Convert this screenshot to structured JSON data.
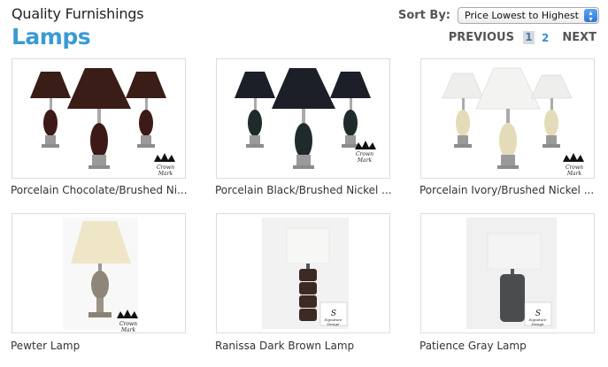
{
  "header": {
    "store_name": "Quality Furnishings",
    "category_title": "Lamps"
  },
  "sort": {
    "label": "Sort By:",
    "selected": "Price Lowest to Highest"
  },
  "pager": {
    "prev": "PREVIOUS",
    "current_page": "1",
    "next_page": "2",
    "next": "NEXT"
  },
  "products": [
    {
      "name": "Porcelain Chocolate/Brushed Ni...",
      "shade_color": "#3a1d16",
      "body_color": "#3d1a18",
      "brand": "Crown Mark"
    },
    {
      "name": "Porcelain Black/Brushed Nickel ...",
      "shade_color": "#1c1f27",
      "body_color": "#1f2a2b",
      "brand": "Crown Mark"
    },
    {
      "name": "Porcelain Ivory/Brushed Nickel ...",
      "shade_color": "#eeeeec",
      "body_color": "#e4dcb8",
      "brand": "Crown Mark"
    },
    {
      "name": "Pewter Lamp",
      "shade_color": "#efe6c8",
      "body_color": "#8e8678",
      "brand": "Crown Mark"
    },
    {
      "name": "Ranissa Dark Brown Lamp",
      "shade_color": "#f7f7f5",
      "body_color": "#3d2a24",
      "brand": "Signature Design"
    },
    {
      "name": "Patience Gray Lamp",
      "shade_color": "#f4f4f4",
      "body_color": "#4a4c4d",
      "brand": "Signature Design"
    }
  ]
}
